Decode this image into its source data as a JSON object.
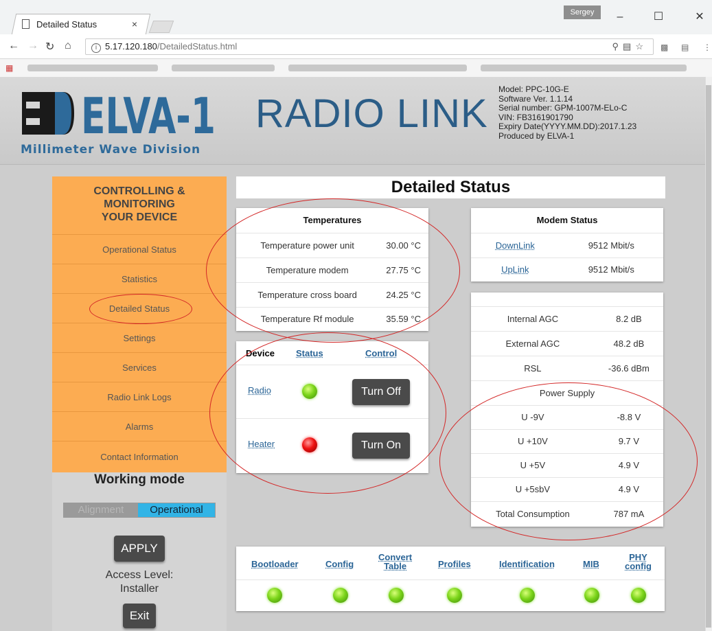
{
  "browser": {
    "tab_title": "Detailed Status",
    "tab_close": "×",
    "profile_name": "Sergey",
    "url_host": "5.17.120.180",
    "url_path": "/DetailedStatus.html"
  },
  "header": {
    "brand": "ELVA-1",
    "brand_subtitle": "Millimeter Wave Division",
    "product_title": "RADIO LINK",
    "device_info": {
      "model": "Model: PPC-10G-E",
      "software": "Software Ver. 1.1.14",
      "serial": "Serial number: GPM-1007M-ELo-C",
      "vin": "VIN: FB3161901790",
      "expiry": "Expiry Date(YYYY.MM.DD):2017.1.23",
      "produced": "Produced by ELVA-1"
    }
  },
  "sidebar": {
    "heading_lines": [
      "CONTROLLING &",
      "MONITORING",
      "YOUR DEVICE"
    ],
    "items": [
      {
        "label": "Operational Status"
      },
      {
        "label": "Statistics"
      },
      {
        "label": "Detailed Status"
      },
      {
        "label": "Settings"
      },
      {
        "label": "Services"
      },
      {
        "label": "Radio Link Logs"
      },
      {
        "label": "Alarms"
      },
      {
        "label": "Contact Information"
      }
    ],
    "working_mode_label": "Working mode",
    "mode_options": {
      "alignment": "Alignment",
      "operational": "Operational"
    },
    "selected_mode": "Operational",
    "apply_label": "APPLY",
    "access_level_label": "Access Level:",
    "access_level_value": "Installer",
    "exit_label": "Exit"
  },
  "main": {
    "page_title": "Detailed Status",
    "temperatures": {
      "title": "Temperatures",
      "rows": [
        {
          "label": "Temperature power unit",
          "value": "30.00 °C"
        },
        {
          "label": "Temperature modem",
          "value": "27.75 °C"
        },
        {
          "label": "Temperature cross board",
          "value": "24.25 °C"
        },
        {
          "label": "Temperature Rf module",
          "value": "35.59 °C"
        }
      ]
    },
    "device_control": {
      "headers": {
        "device": "Device",
        "status": "Status",
        "control": "Control"
      },
      "rows": [
        {
          "device": "Radio",
          "status": "on",
          "led_color": "#7bd41a",
          "button": "Turn Off"
        },
        {
          "device": "Heater",
          "status": "off",
          "led_color": "#ee1111",
          "button": "Turn On"
        }
      ]
    },
    "modem_status": {
      "title": "Modem Status",
      "rows": [
        {
          "label": "DownLink",
          "value": "9512 Mbit/s"
        },
        {
          "label": "UpLink",
          "value": "9512 Mbit/s"
        }
      ]
    },
    "agc": {
      "rows": [
        {
          "label": "Internal AGC",
          "value": "8.2 dB"
        },
        {
          "label": "External AGC",
          "value": "48.2 dB"
        },
        {
          "label": "RSL",
          "value": "-36.6 dBm"
        }
      ]
    },
    "power_supply": {
      "title": "Power Supply",
      "rows": [
        {
          "label": "U -9V",
          "value": "-8.8 V"
        },
        {
          "label": "U +10V",
          "value": "9.7 V"
        },
        {
          "label": "U +5V",
          "value": "4.9 V"
        },
        {
          "label": "U +5sbV",
          "value": "4.9 V"
        },
        {
          "label": "Total Consumption",
          "value": "787 mA"
        }
      ]
    },
    "services_bar": [
      {
        "label": "Bootloader"
      },
      {
        "label": "Config"
      },
      {
        "label": "Convert Table",
        "line1": "Convert",
        "line2": "Table"
      },
      {
        "label": "Profiles"
      },
      {
        "label": "Identification"
      },
      {
        "label": "MIB"
      },
      {
        "label": "PHY config",
        "line1": "PHY",
        "line2": "config"
      }
    ]
  },
  "colors": {
    "sidebar_orange": "#fcac52",
    "title_blue": "#2b5d87",
    "link_blue": "#2a6496",
    "mode_active": "#32b4e6",
    "annotation_red": "#d32626"
  }
}
